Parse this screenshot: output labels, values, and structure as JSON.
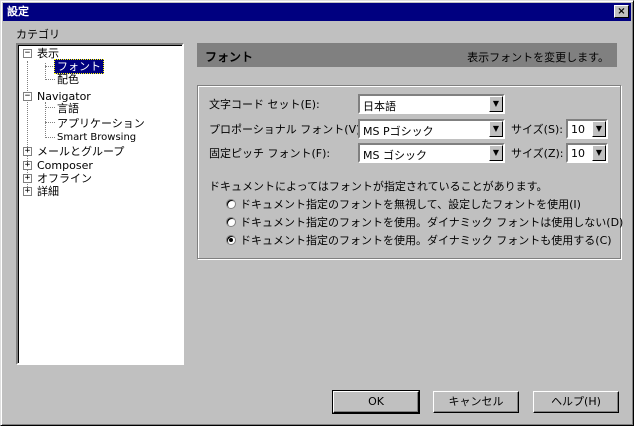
{
  "window": {
    "title": "設定",
    "close": "×"
  },
  "category_label": "カテゴリ",
  "tree": {
    "display": "表示",
    "font": "フォント",
    "colors": "配色",
    "navigator": "Navigator",
    "language": "言語",
    "applications": "アプリケーション",
    "smart_browsing": "Smart Browsing",
    "mail": "メールとグループ",
    "composer": "Composer",
    "offline": "オフライン",
    "advanced": "詳細",
    "expand_plus": "+",
    "expand_minus": "−"
  },
  "header": {
    "title": "フォント",
    "description": "表示フォントを変更します。"
  },
  "form": {
    "charset_label": "文字コード セット(E):",
    "charset_value": "日本語",
    "prop_font_label": "プロポーショナル フォント(V):",
    "prop_font_value": "MS Pゴシック",
    "prop_size_label": "サイズ(S):",
    "prop_size_value": "10",
    "fixed_font_label": "固定ピッチ フォント(F):",
    "fixed_font_value": "MS ゴシック",
    "fixed_size_label": "サイズ(Z):",
    "fixed_size_value": "10",
    "doc_note": "ドキュメントによってはフォントが指定されていることがあります。",
    "radio1": "ドキュメント指定のフォントを無視して、設定したフォントを使用(I)",
    "radio2": "ドキュメント指定のフォントを使用。ダイナミック フォントは使用しない(D)",
    "radio3": "ドキュメント指定のフォントを使用。ダイナミック フォントも使用する(C)",
    "selected_radio": 3
  },
  "buttons": {
    "ok": "OK",
    "cancel": "キャンセル",
    "help": "ヘルプ(H)"
  }
}
